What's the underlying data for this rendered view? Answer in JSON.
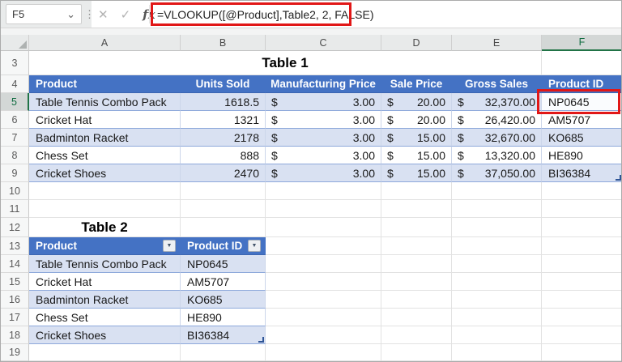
{
  "formula_bar": {
    "name_box_value": "F5",
    "chevron": "⌄",
    "dots": "⋮",
    "cancel_label": "✕",
    "enter_label": "✓",
    "fx_label": "fx",
    "formula": "=VLOOKUP([@Product],Table2, 2, FALSE)"
  },
  "grid": {
    "column_headers": [
      "A",
      "B",
      "C",
      "D",
      "E",
      "F"
    ],
    "selected_column": "F",
    "selected_row": "5",
    "row_numbers": [
      "3",
      "4",
      "5",
      "6",
      "7",
      "8",
      "9",
      "10",
      "11",
      "12",
      "13",
      "14",
      "15",
      "16",
      "17",
      "18",
      "19"
    ]
  },
  "table1": {
    "title": "Table 1",
    "currency": "$",
    "headers": [
      "Product",
      "Units Sold",
      "Manufacturing Price",
      "Sale Price",
      "Gross Sales",
      "Product ID"
    ],
    "rows": [
      {
        "product": "Table Tennis Combo Pack",
        "units_sold": "1618.5",
        "manufacturing_price": "3.00",
        "sale_price": "20.00",
        "gross_sales": "32,370.00",
        "product_id": "NP0645"
      },
      {
        "product": "Cricket Hat",
        "units_sold": "1321",
        "manufacturing_price": "3.00",
        "sale_price": "20.00",
        "gross_sales": "26,420.00",
        "product_id": "AM5707"
      },
      {
        "product": "Badminton Racket",
        "units_sold": "2178",
        "manufacturing_price": "3.00",
        "sale_price": "15.00",
        "gross_sales": "32,670.00",
        "product_id": "KO685"
      },
      {
        "product": "Chess Set",
        "units_sold": "888",
        "manufacturing_price": "3.00",
        "sale_price": "15.00",
        "gross_sales": "13,320.00",
        "product_id": "HE890"
      },
      {
        "product": "Cricket Shoes",
        "units_sold": "2470",
        "manufacturing_price": "3.00",
        "sale_price": "15.00",
        "gross_sales": "37,050.00",
        "product_id": "BI36384"
      }
    ]
  },
  "table2": {
    "title": "Table 2",
    "filter_icon": "▼",
    "headers": [
      "Product",
      "Product ID"
    ],
    "rows": [
      {
        "product": "Table Tennis Combo Pack",
        "product_id": "NP0645"
      },
      {
        "product": "Cricket Hat",
        "product_id": "AM5707"
      },
      {
        "product": "Badminton Racket",
        "product_id": "KO685"
      },
      {
        "product": "Chess Set",
        "product_id": "HE890"
      },
      {
        "product": "Cricket Shoes",
        "product_id": "BI36384"
      }
    ]
  },
  "colors": {
    "table_header_blue": "#4472C4",
    "banded_row_blue": "#D9E1F2",
    "table_border_blue": "#8EA9DB",
    "annotation_red": "#E11717",
    "selection_green": "#217346"
  }
}
